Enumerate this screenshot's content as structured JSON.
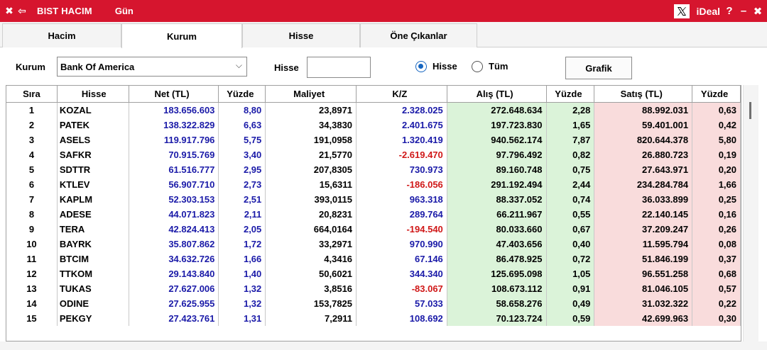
{
  "titlebar": {
    "close_glyph": "✖",
    "back_glyph": "⇦",
    "title": "BIST HACIM",
    "period": "Gün",
    "x_glyph": "𝕏",
    "brand": "iDeal",
    "help": "?",
    "minimize": "–",
    "close": "✖",
    "colors": {
      "background": "#d6152e"
    }
  },
  "tabs": [
    {
      "label": "Hacim",
      "active": false
    },
    {
      "label": "Kurum",
      "active": true
    },
    {
      "label": "Hisse",
      "active": false
    },
    {
      "label": "Öne Çıkanlar",
      "active": false
    }
  ],
  "filters": {
    "kurum_label": "Kurum",
    "kurum_value": "Bank Of America",
    "chevron": "⌵",
    "hisse_label": "Hisse",
    "hisse_value": "",
    "radio_hisse": "Hisse",
    "radio_tum": "Tüm",
    "radio_selected": "Hisse",
    "grafik_button": "Grafik"
  },
  "table": {
    "headers": [
      "Sıra",
      "Hisse",
      "Net (TL)",
      "Yüzde",
      "Maliyet",
      "K/Z",
      "Alış (TL)",
      "Yüzde",
      "Satış (TL)",
      "Yüzde"
    ],
    "rows": [
      [
        "1",
        "KOZAL",
        "183.656.603",
        "8,80",
        "23,8971",
        "2.328.025",
        "272.648.634",
        "2,28",
        "88.992.031",
        "0,63"
      ],
      [
        "2",
        "PATEK",
        "138.322.829",
        "6,63",
        "34,3830",
        "2.401.675",
        "197.723.830",
        "1,65",
        "59.401.001",
        "0,42"
      ],
      [
        "3",
        "ASELS",
        "119.917.796",
        "5,75",
        "191,0958",
        "1.320.419",
        "940.562.174",
        "7,87",
        "820.644.378",
        "5,80"
      ],
      [
        "4",
        "SAFKR",
        "70.915.769",
        "3,40",
        "21,5770",
        "-2.619.470",
        "97.796.492",
        "0,82",
        "26.880.723",
        "0,19"
      ],
      [
        "5",
        "SDTTR",
        "61.516.777",
        "2,95",
        "207,8305",
        "730.973",
        "89.160.748",
        "0,75",
        "27.643.971",
        "0,20"
      ],
      [
        "6",
        "KTLEV",
        "56.907.710",
        "2,73",
        "15,6311",
        "-186.056",
        "291.192.494",
        "2,44",
        "234.284.784",
        "1,66"
      ],
      [
        "7",
        "KAPLM",
        "52.303.153",
        "2,51",
        "393,0115",
        "963.318",
        "88.337.052",
        "0,74",
        "36.033.899",
        "0,25"
      ],
      [
        "8",
        "ADESE",
        "44.071.823",
        "2,11",
        "20,8231",
        "289.764",
        "66.211.967",
        "0,55",
        "22.140.145",
        "0,16"
      ],
      [
        "9",
        "TERA",
        "42.824.413",
        "2,05",
        "664,0164",
        "-194.540",
        "80.033.660",
        "0,67",
        "37.209.247",
        "0,26"
      ],
      [
        "10",
        "BAYRK",
        "35.807.862",
        "1,72",
        "33,2971",
        "970.990",
        "47.403.656",
        "0,40",
        "11.595.794",
        "0,08"
      ],
      [
        "11",
        "BTCIM",
        "34.632.726",
        "1,66",
        "4,3416",
        "67.146",
        "86.478.925",
        "0,72",
        "51.846.199",
        "0,37"
      ],
      [
        "12",
        "TTKOM",
        "29.143.840",
        "1,40",
        "50,6021",
        "344.340",
        "125.695.098",
        "1,05",
        "96.551.258",
        "0,68"
      ],
      [
        "13",
        "TUKAS",
        "27.627.006",
        "1,32",
        "3,8516",
        "-83.067",
        "108.673.112",
        "0,91",
        "81.046.105",
        "0,57"
      ],
      [
        "14",
        "ODINE",
        "27.625.955",
        "1,32",
        "153,7825",
        "57.033",
        "58.658.276",
        "0,49",
        "31.032.322",
        "0,22"
      ],
      [
        "15",
        "PEKGY",
        "27.423.761",
        "1,31",
        "7,2911",
        "108.692",
        "70.123.724",
        "0,59",
        "42.699.963",
        "0,30"
      ]
    ],
    "colors": {
      "positive": "#1a1aa8",
      "negative": "#d01818",
      "buy_bg": "#dbf3d9",
      "sell_bg": "#f9dcdc"
    }
  }
}
